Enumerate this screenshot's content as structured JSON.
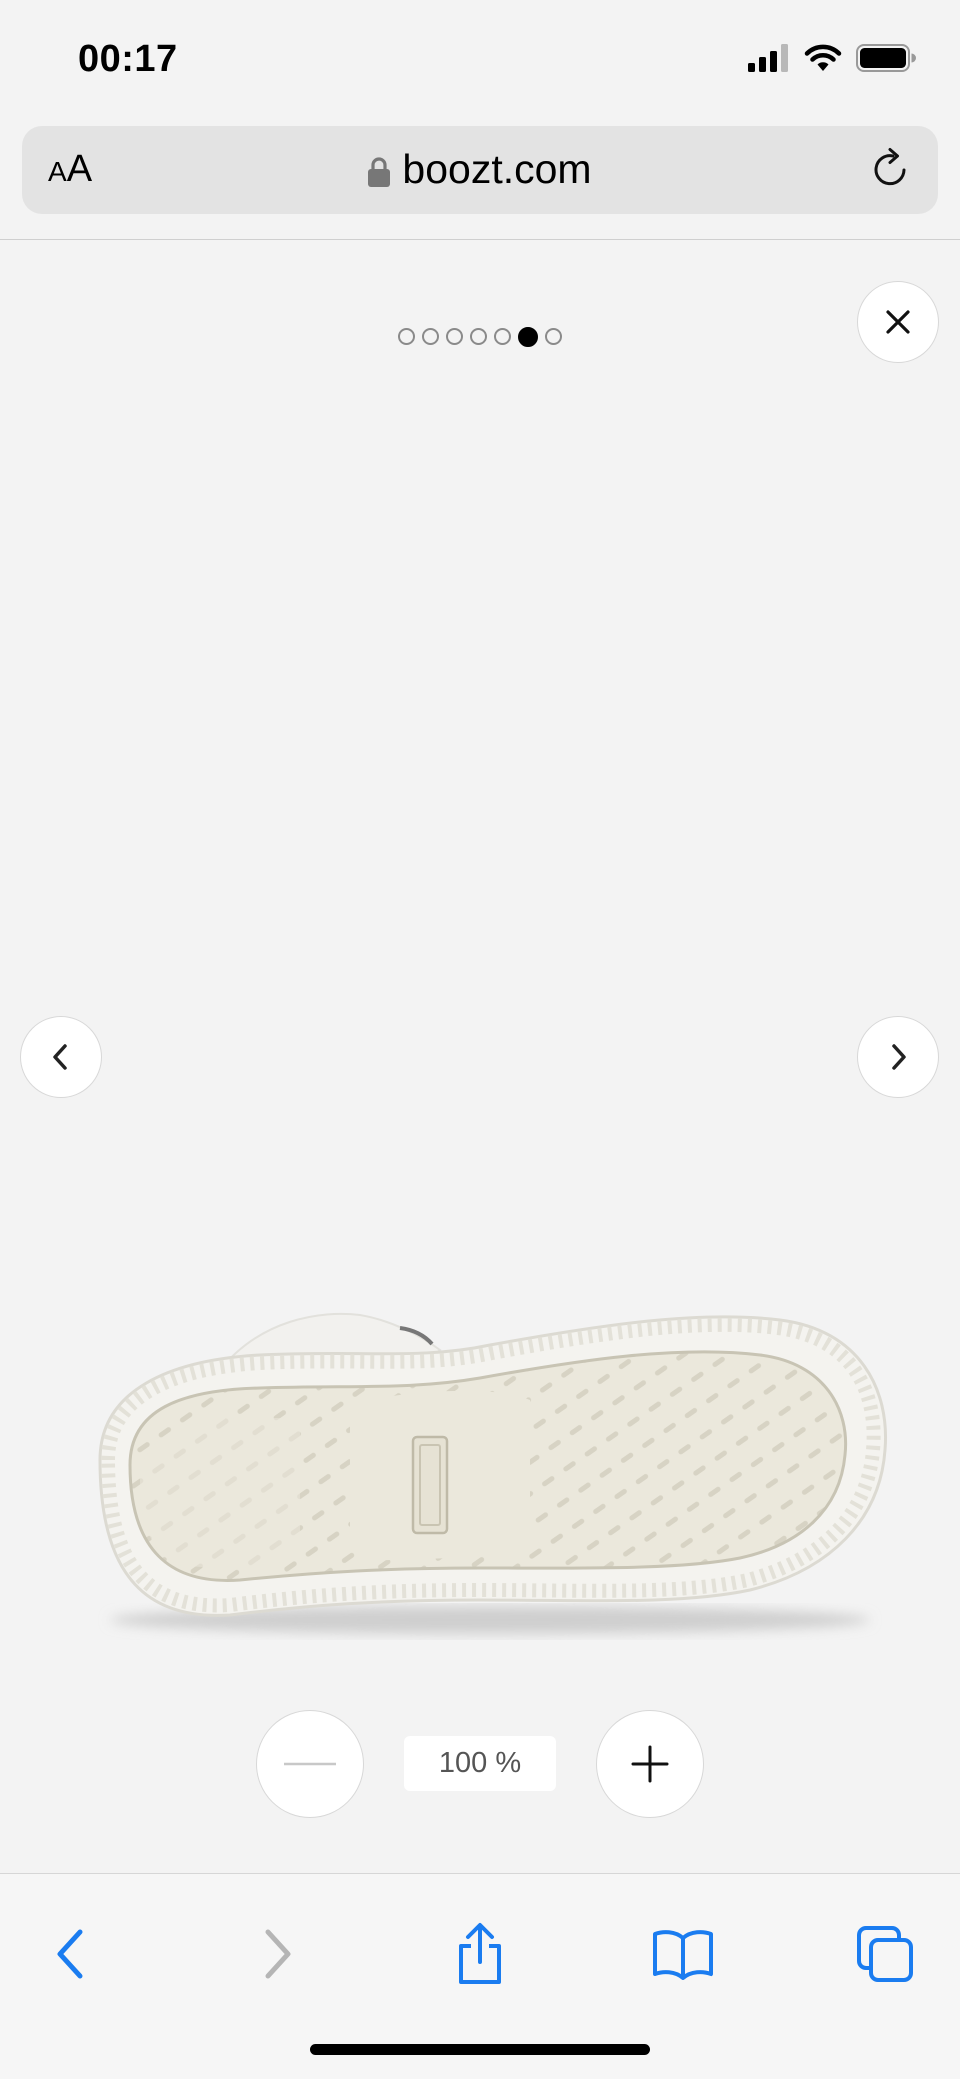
{
  "status_bar": {
    "time": "00:17"
  },
  "browser": {
    "text_size_small": "A",
    "text_size_large": "A",
    "domain": "boozt.com"
  },
  "gallery": {
    "image_count": 7,
    "active_index": 5,
    "product_image_icon": "shoe-sole-image"
  },
  "zoom": {
    "level": "100 %"
  },
  "icons": {
    "close": "close-icon",
    "prev": "chevron-left-icon",
    "next": "chevron-right-icon",
    "zoom_out": "minus-icon",
    "zoom_in": "plus-icon",
    "back": "back-arrow-icon",
    "forward": "forward-arrow-icon",
    "share": "share-icon",
    "bookmarks": "bookmarks-icon",
    "tabs": "tabs-icon"
  },
  "colors": {
    "toolbar_accent": "#1a7cf0",
    "disabled": "#b5b5b5",
    "page_background": "#f3f3f3"
  }
}
